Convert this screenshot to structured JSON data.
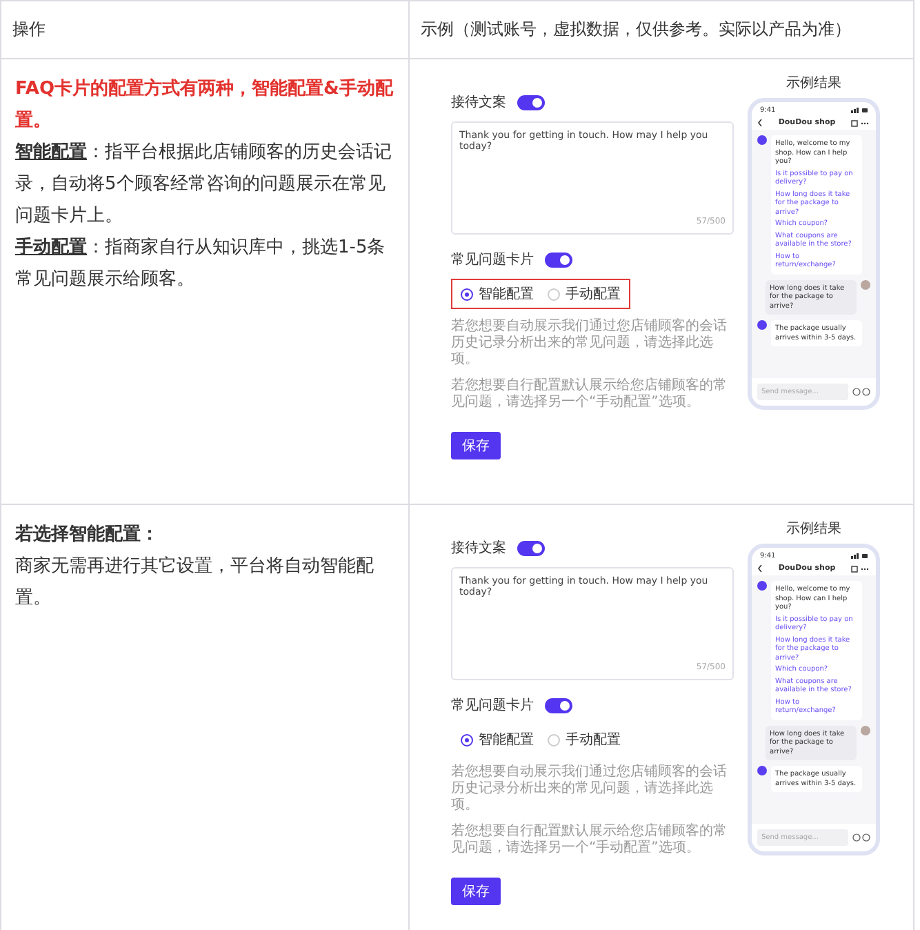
{
  "table": {
    "columns": [
      "操作",
      "示例（测试账号，虚拟数据，仅供参考。实际以产品为准）"
    ],
    "rows": [
      {
        "instructions": [
          {
            "kind": "alert",
            "text": "FAQ卡片的配置方式有两种，智能配置&手动配置。"
          },
          {
            "kind": "term",
            "term": "智能配置",
            "text": "：指平台根据此店铺顾客的历史会话记录，自动将5个顾客经常咨询的问题展示在常见问题卡片上。"
          },
          {
            "kind": "term",
            "term": "手动配置",
            "text": "：指商家自行从知识库中，挑选1-5条常见问题展示给顾客。"
          }
        ],
        "example": {
          "reply_label": "接待文案",
          "reply_toggle_on": true,
          "reply_text": "Thank you for getting in touch. How may I help you today?",
          "reply_count": "57/500",
          "faq_label": "常见问题卡片",
          "faq_toggle_on": true,
          "highlighted": true,
          "options": [
            {
              "label": "智能配置",
              "selected": true
            },
            {
              "label": "手动配置",
              "selected": false
            }
          ],
          "notes": [
            "若您想要自动展示我们通过您店铺顾客的会话历史记录分析出来的常见问题，请选择此选项。",
            "若您想要自行配置默认展示给您店铺顾客的常见问题，请选择另一个“手动配置”选项。"
          ],
          "save_button": "保存",
          "preview": {
            "title": "示例结果",
            "time": "9:41",
            "shop_name": "DouDou shop",
            "greeting": "Hello, welcome to my shop. How can I help you?",
            "suggestions": [
              "Is it possible to pay on delivery?",
              "How long does it take for the package to arrive?",
              "Which coupon?",
              "What coupons are available in the store?",
              "How to return/exchange?"
            ],
            "user_message": "How long does it take for the package to arrive?",
            "reply": "The package usually arrives within 3-5 days.",
            "input_placeholder": "Send message..."
          }
        }
      },
      {
        "instructions": [
          {
            "kind": "heading",
            "text": "若选择智能配置："
          },
          {
            "kind": "para",
            "text": "商家无需再进行其它设置，平台将自动智能配置。"
          }
        ],
        "example": {
          "reply_label": "接待文案",
          "reply_toggle_on": true,
          "reply_text": "Thank you for getting in touch. How may I help you today?",
          "reply_count": "57/500",
          "faq_label": "常见问题卡片",
          "faq_toggle_on": true,
          "highlighted": false,
          "options": [
            {
              "label": "智能配置",
              "selected": true
            },
            {
              "label": "手动配置",
              "selected": false
            }
          ],
          "notes": [
            "若您想要自动展示我们通过您店铺顾客的会话历史记录分析出来的常见问题，请选择此选项。",
            "若您想要自行配置默认展示给您店铺顾客的常见问题，请选择另一个“手动配置”选项。"
          ],
          "save_button": "保存",
          "preview": {
            "title": "示例结果",
            "time": "9:41",
            "shop_name": "DouDou shop",
            "greeting": "Hello, welcome to my shop. How can I help you?",
            "suggestions": [
              "Is it possible to pay on delivery?",
              "How long does it take for the package to arrive?",
              "Which coupon?",
              "What coupons are available in the store?",
              "How to return/exchange?"
            ],
            "user_message": "How long does it take for the package to arrive?",
            "reply": "The package usually arrives within 3-5 days.",
            "input_placeholder": "Send message..."
          }
        }
      }
    ]
  }
}
